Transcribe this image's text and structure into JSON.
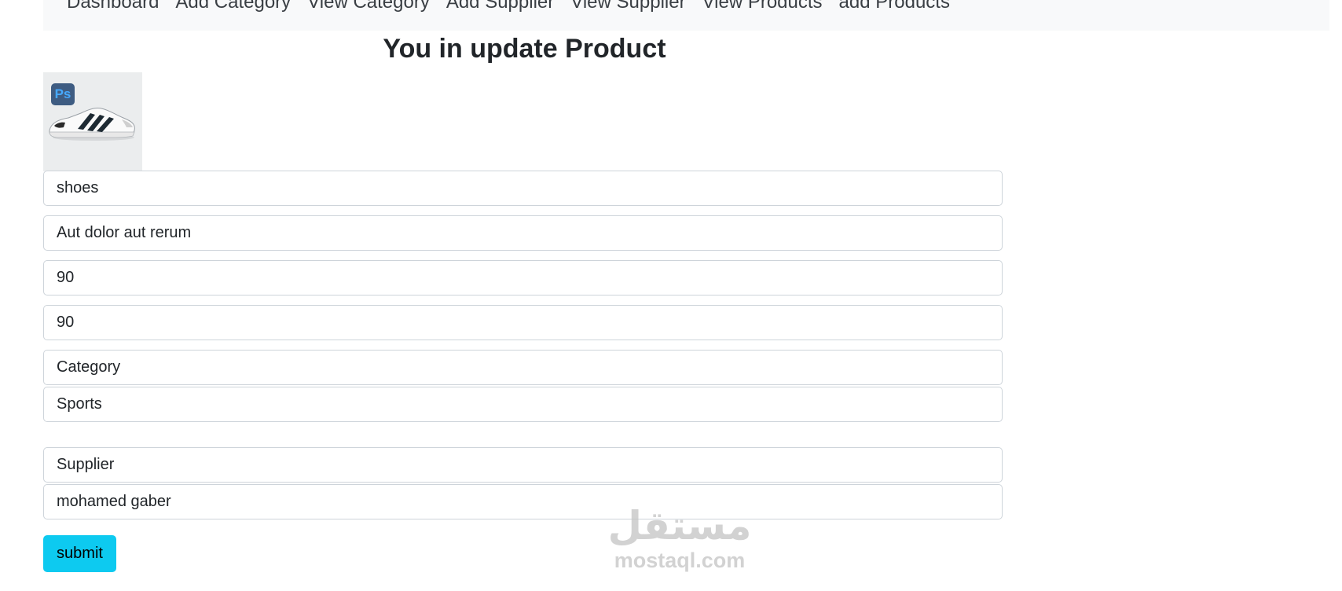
{
  "nav": {
    "items": [
      "Dashboard",
      "Add Category",
      "View Category",
      "Add Supplier",
      "View Supplier",
      "View Products",
      "add Products"
    ]
  },
  "page": {
    "title": "You in update Product"
  },
  "image": {
    "badge": "Ps",
    "description": "white sneaker with black stripes"
  },
  "form": {
    "name": "shoes",
    "description": "Aut dolor aut rerum",
    "price": "90",
    "quantity": "90",
    "category_label": "Category",
    "category_value": "Sports",
    "supplier_label": "Supplier",
    "supplier_value": "mohamed gaber",
    "submit_label": "submit"
  },
  "watermark": {
    "logo": "مستقل",
    "url": "mostaql.com"
  }
}
